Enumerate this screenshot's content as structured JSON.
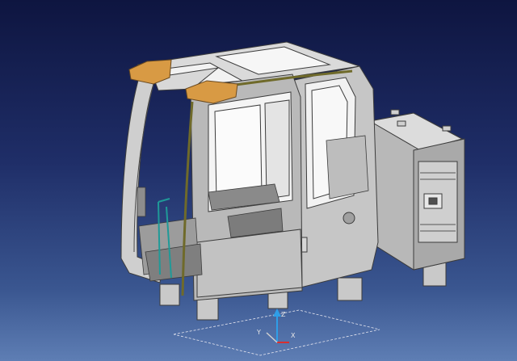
{
  "viewport": {
    "model": "excavator-operator-cab",
    "background": {
      "top": "#0e1540",
      "bottom": "#5e7eb4"
    }
  },
  "colors": {
    "body_light": "#d4d4d4",
    "body_mid": "#b4b4b4",
    "body_dark": "#8c8c8c",
    "edge": "#3c3c3c",
    "glass": "#f4f4f4",
    "trim_olive": "#6f6a2a",
    "mirror_orange": "#d89a44",
    "pedal_teal": "#1f9a98"
  },
  "compass": {
    "axes": [
      {
        "name": "X",
        "color": "#d83030"
      },
      {
        "name": "Y",
        "color": "#d0d0d0"
      },
      {
        "name": "Z",
        "color": "#2f9ee8"
      }
    ]
  }
}
